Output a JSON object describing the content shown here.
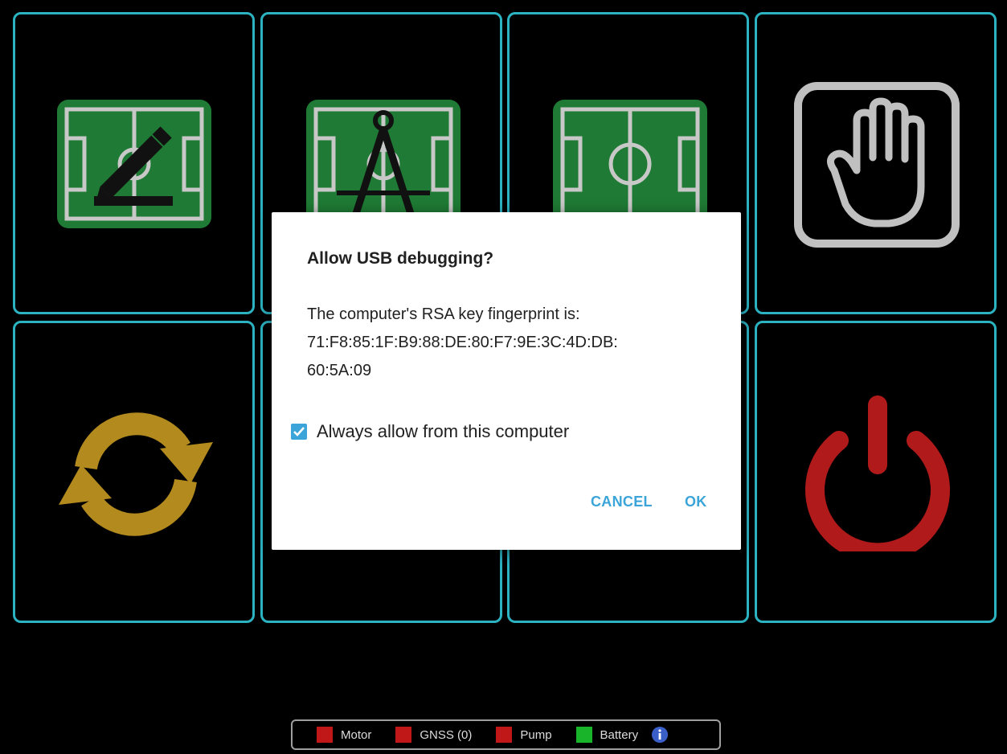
{
  "dialog": {
    "title": "Allow USB debugging?",
    "message_line1": "The computer's RSA key fingerprint is:",
    "message_line2": "71:F8:85:1F:B9:88:DE:80:F7:9E:3C:4D:DB:",
    "message_line3": "60:5A:09",
    "checkbox_label": "Always allow from this computer",
    "checkbox_checked": true,
    "cancel_label": "CANCEL",
    "ok_label": "OK"
  },
  "tiles": [
    {
      "name": "edit-field",
      "icon": "pencil-field-icon"
    },
    {
      "name": "measure-field",
      "icon": "compass-field-icon"
    },
    {
      "name": "field",
      "icon": "soccer-field-icon"
    },
    {
      "name": "stop",
      "icon": "hand-icon"
    },
    {
      "name": "sync",
      "icon": "refresh-icon"
    },
    {
      "name": "tile-6",
      "icon": "hidden"
    },
    {
      "name": "tile-7",
      "icon": "hidden"
    },
    {
      "name": "power",
      "icon": "power-icon"
    }
  ],
  "status": {
    "items": [
      {
        "label": "Motor",
        "color": "#c01818"
      },
      {
        "label": "GNSS (0)",
        "color": "#c01818"
      },
      {
        "label": "Pump",
        "color": "#c01818"
      },
      {
        "label": "Battery",
        "color": "#19b42a"
      }
    ],
    "info_icon": "info-icon"
  },
  "colors": {
    "tile_border": "#2bb3c2",
    "field_green": "#1e7a34",
    "accent_blue": "#3ba4d8",
    "refresh_gold": "#b38a1e",
    "power_red": "#b01a1a"
  }
}
